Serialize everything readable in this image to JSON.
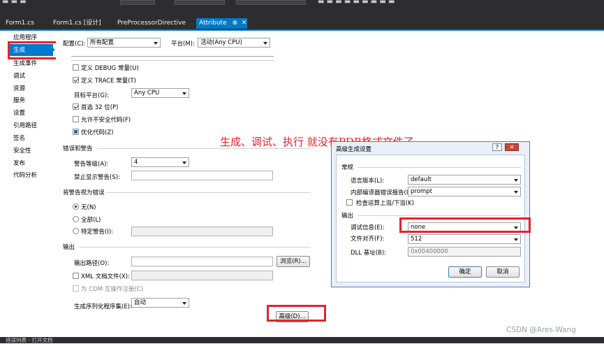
{
  "tabs": [
    "Form1.cs",
    "Form1.cs [设计]",
    "PreProcessorDirective",
    "Attribute"
  ],
  "tab_active_pin": "⊕",
  "tab_active_close": "✕",
  "sidebar": {
    "items": [
      "应用程序",
      "生成",
      "生成事件",
      "调试",
      "资源",
      "服务",
      "设置",
      "引用路径",
      "签名",
      "安全性",
      "发布",
      "代码分析"
    ]
  },
  "header": {
    "config_label": "配置(C):",
    "config_value": "所有配置",
    "platform_label": "平台(M):",
    "platform_value": "活动(Any CPU)"
  },
  "general": {
    "define_debug": "定义 DEBUG 常量(U)",
    "define_debug_checked": false,
    "define_trace": "定义 TRACE 常量(T)",
    "define_trace_checked": true,
    "target_label": "目标平台(G):",
    "target_value": "Any CPU",
    "prefer32": "首选 32 位(P)",
    "prefer32_checked": true,
    "unsafe": "允许不安全代码(F)",
    "unsafe_checked": false,
    "optimize": "优化代码(Z)",
    "optimize_checked": true
  },
  "errors": {
    "section": "错误和警告",
    "warn_level_label": "警告等级(A):",
    "warn_level_value": "4",
    "suppress_label": "禁止显示警告(S):"
  },
  "treat": {
    "section": "将警告视为错误",
    "none": "无(N)",
    "all": "全部(L)",
    "specific": "特定警告(I):",
    "selected": "none"
  },
  "output": {
    "section": "输出",
    "path_label": "输出路径(O):",
    "browse": "浏览(R)...",
    "xml_label": "XML 文档文件(X):",
    "com": "为 COM 互操作注册(C)",
    "serialize_label": "生成序列化程序集(E):",
    "serialize_value": "自动",
    "advanced": "高级(D)..."
  },
  "annotation": "生成、调试、执行 就没有PDB格式文件了",
  "dialog": {
    "title": "高级生成设置",
    "help": "?",
    "close": "✕",
    "general": "常规",
    "lang_label": "语言版本(L):",
    "lang_value": "default",
    "report_label": "内部编译器错误报告(I):",
    "report_value": "prompt",
    "overflow": "检查运算上溢/下溢(K)",
    "output": "输出",
    "debug_label": "调试信息(E):",
    "debug_value": "none",
    "align_label": "文件对齐(F):",
    "align_value": "512",
    "dll_label": "DLL 基址(B):",
    "dll_value": "0x00400000",
    "ok": "确定",
    "cancel": "取消"
  },
  "status": "错误列表 - 打开文档",
  "watermark": "CSDN @Ares-Wang"
}
